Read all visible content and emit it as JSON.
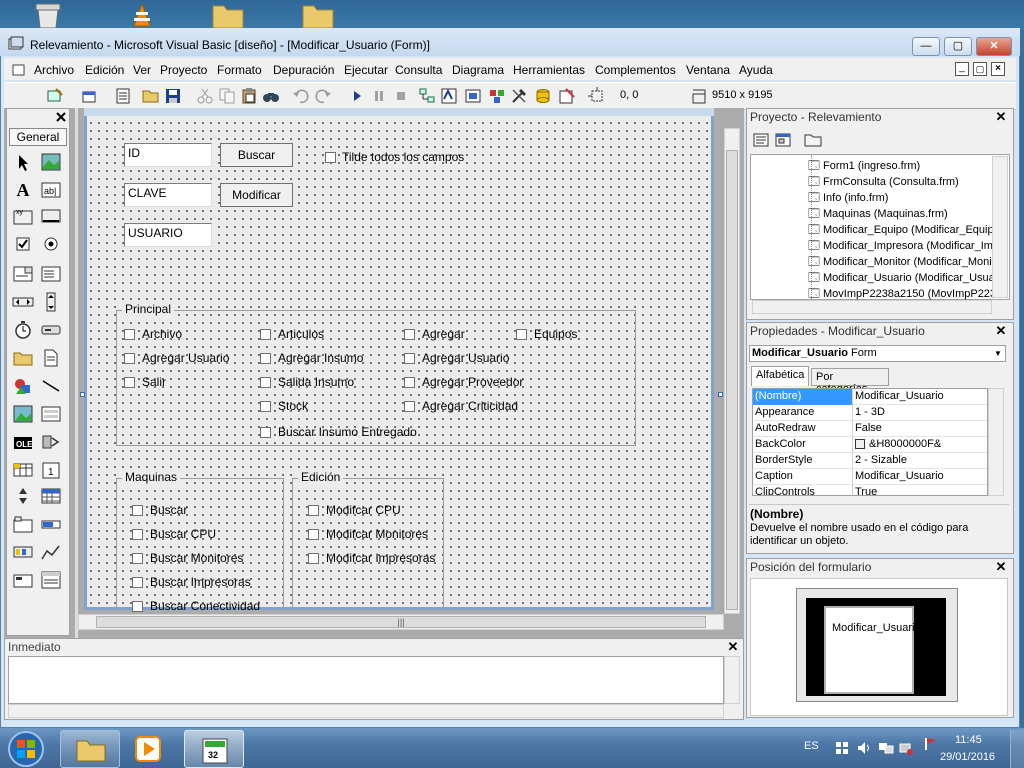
{
  "window": {
    "title": "Relevamiento - Microsoft Visual Basic [diseño] - [Modificar_Usuario (Form)]",
    "minimize": "—",
    "maximize": "▢",
    "close": "✕"
  },
  "menu": [
    "Archivo",
    "Edición",
    "Ver",
    "Proyecto",
    "Formato",
    "Depuración",
    "Ejecutar",
    "Consulta",
    "Diagrama",
    "Herramientas",
    "Complementos",
    "Ventana",
    "Ayuda"
  ],
  "toolbar": {
    "position": "0, 0",
    "size": "9510 x 9195"
  },
  "toolbox": {
    "tab_label": "General"
  },
  "form": {
    "title": "Modificar_Usuario",
    "fields": {
      "id": "ID",
      "clave": "CLAVE",
      "usuario": "USUARIO"
    },
    "buttons": {
      "buscar": "Buscar",
      "modificar": "Modificar"
    },
    "tilde_todos": "Tilde todos los campos",
    "principal": {
      "caption": "Principal",
      "items": [
        "Archivo",
        "Agregar Usuario",
        "Salir",
        "Articulos",
        "Agregar Insumo",
        "Salida Insumo",
        "Stock",
        "Buscar Insumo Entregado",
        "Agregar",
        "Agregar Usuario",
        "Agregar Proveedor",
        "Agregar Criticidad",
        "Equipos"
      ]
    },
    "maquinas": {
      "caption": "Maquinas",
      "items": [
        "Buscar",
        "Buscar CPU",
        "Buscar Monitores",
        "Buscar Impresoras",
        "Buscar Conectividad"
      ]
    },
    "edicion": {
      "caption": "Edición",
      "items": [
        "Modifcar CPU",
        "Modifcar Monitores",
        "Modifcar Impresoras"
      ]
    }
  },
  "immediate": {
    "title": "Inmediato"
  },
  "project": {
    "title": "Proyecto - Relevamiento",
    "items": [
      "Form1 (ingreso.frm)",
      "FrmConsulta (Consulta.frm)",
      "Info (info.frm)",
      "Maquinas (Maquinas.frm)",
      "Modificar_Equipo (Modificar_Equip",
      "Modificar_Impresora (Modificar_Im",
      "Modificar_Monitor (Modificar_Moni",
      "Modificar_Usuario (Modificar_Usua",
      "MovImpP2238a2150 (MovImpP223"
    ]
  },
  "properties": {
    "title": "Propiedades - Modificar_Usuario",
    "object_name": "Modificar_Usuario",
    "object_type": "Form",
    "tab_alpha": "Alfabética",
    "tab_cat": "Por categorías",
    "rows": [
      {
        "name": "(Nombre)",
        "value": "Modificar_Usuario"
      },
      {
        "name": "Appearance",
        "value": "1 - 3D"
      },
      {
        "name": "AutoRedraw",
        "value": "False"
      },
      {
        "name": "BackColor",
        "value": "&H8000000F&"
      },
      {
        "name": "BorderStyle",
        "value": "2 - Sizable"
      },
      {
        "name": "Caption",
        "value": "Modificar_Usuario"
      },
      {
        "name": "ClipControls",
        "value": "True"
      }
    ],
    "desc_title": "(Nombre)",
    "desc_text": "Devuelve el nombre usado en el código para identificar un objeto."
  },
  "position_panel": {
    "title": "Posición del formulario",
    "preview_label": "Modificar_Usuari"
  },
  "taskbar": {
    "lang": "ES",
    "time": "11:45",
    "date": "29/01/2016",
    "badge": "32"
  },
  "colors": {
    "selection": "#3399ff",
    "accent": "#c8432a"
  }
}
